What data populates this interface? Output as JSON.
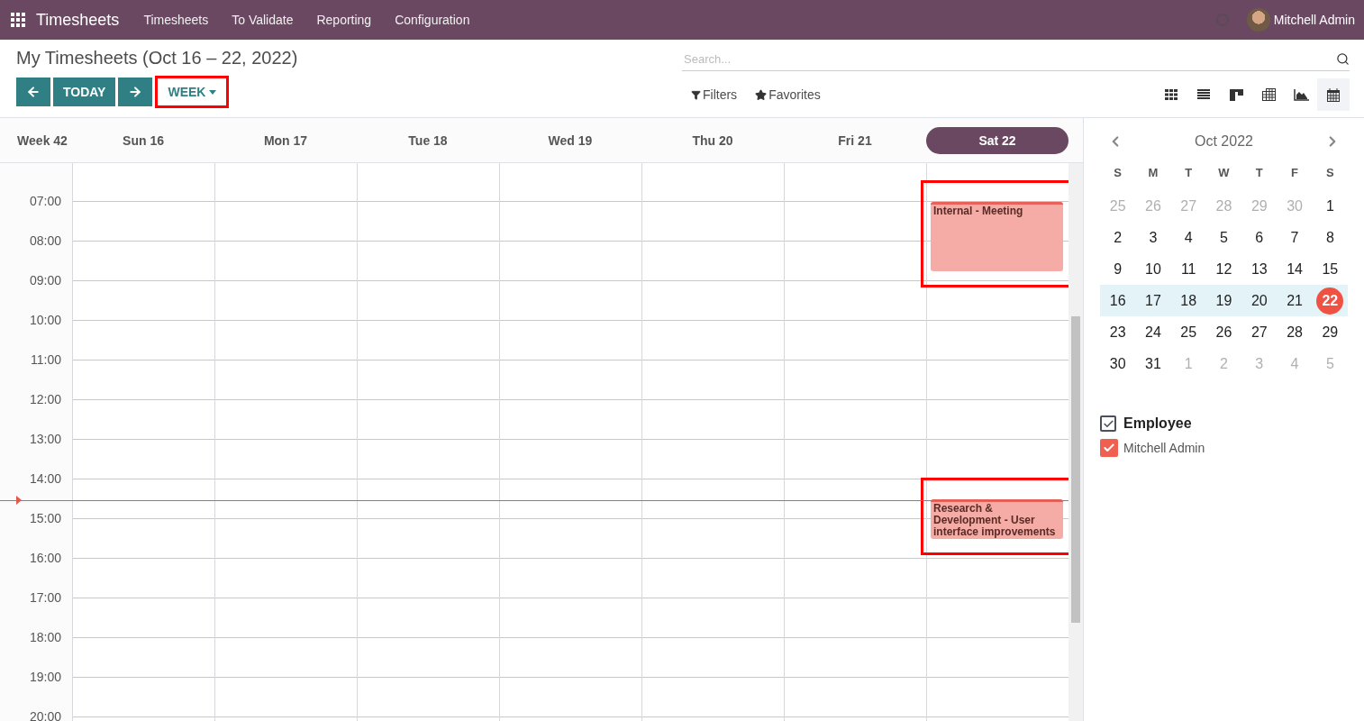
{
  "navbar": {
    "app_name": "Timesheets",
    "menus": [
      "Timesheets",
      "To Validate",
      "Reporting",
      "Configuration"
    ],
    "user": "Mitchell Admin"
  },
  "control_panel": {
    "title": "My Timesheets (Oct 16 – 22, 2022)",
    "today_label": "TODAY",
    "scale": {
      "label": "WEEK",
      "highlighted": true
    },
    "search": {
      "placeholder": "Search..."
    },
    "filters_label": "Filters",
    "favorites_label": "Favorites",
    "views": [
      {
        "kind": "kanban",
        "selected": false
      },
      {
        "kind": "list",
        "selected": false
      },
      {
        "kind": "grid",
        "selected": false
      },
      {
        "kind": "pivot",
        "selected": false
      },
      {
        "kind": "graph",
        "selected": false
      },
      {
        "kind": "calendar",
        "selected": true
      }
    ]
  },
  "calendar": {
    "week_label": "Week 42",
    "hours": [
      "07:00",
      "08:00",
      "09:00",
      "10:00",
      "11:00",
      "12:00",
      "13:00",
      "14:00",
      "15:00",
      "16:00",
      "17:00",
      "18:00",
      "19:00",
      "20:00"
    ],
    "days": [
      {
        "label": "Sun 16",
        "selected": false
      },
      {
        "label": "Mon 17",
        "selected": false
      },
      {
        "label": "Tue 18",
        "selected": false
      },
      {
        "label": "Wed 19",
        "selected": false
      },
      {
        "label": "Thu 20",
        "selected": false
      },
      {
        "label": "Fri 21",
        "selected": false
      },
      {
        "label": "Sat 22",
        "selected": true,
        "events": [
          {
            "title": "Internal - Meeting",
            "highlighted": true
          },
          {
            "title": "Research & Development - User interface improvements",
            "highlighted": true
          }
        ]
      }
    ]
  },
  "sidebar": {
    "month": "Oct 2022",
    "weekdays": [
      "S",
      "M",
      "T",
      "W",
      "T",
      "F",
      "S"
    ],
    "weeks": [
      {
        "selected": false,
        "days": [
          {
            "label": "25",
            "muted": true,
            "today": false
          },
          {
            "label": "26",
            "muted": true,
            "today": false
          },
          {
            "label": "27",
            "muted": true,
            "today": false
          },
          {
            "label": "28",
            "muted": true,
            "today": false
          },
          {
            "label": "29",
            "muted": true,
            "today": false
          },
          {
            "label": "30",
            "muted": true,
            "today": false
          },
          {
            "label": "1",
            "muted": false,
            "today": false
          }
        ]
      },
      {
        "selected": false,
        "days": [
          {
            "label": "2",
            "muted": false,
            "today": false
          },
          {
            "label": "3",
            "muted": false,
            "today": false
          },
          {
            "label": "4",
            "muted": false,
            "today": false
          },
          {
            "label": "5",
            "muted": false,
            "today": false
          },
          {
            "label": "6",
            "muted": false,
            "today": false
          },
          {
            "label": "7",
            "muted": false,
            "today": false
          },
          {
            "label": "8",
            "muted": false,
            "today": false
          }
        ]
      },
      {
        "selected": false,
        "days": [
          {
            "label": "9",
            "muted": false,
            "today": false
          },
          {
            "label": "10",
            "muted": false,
            "today": false
          },
          {
            "label": "11",
            "muted": false,
            "today": false
          },
          {
            "label": "12",
            "muted": false,
            "today": false
          },
          {
            "label": "13",
            "muted": false,
            "today": false
          },
          {
            "label": "14",
            "muted": false,
            "today": false
          },
          {
            "label": "15",
            "muted": false,
            "today": false
          }
        ]
      },
      {
        "selected": true,
        "days": [
          {
            "label": "16",
            "muted": false,
            "today": false
          },
          {
            "label": "17",
            "muted": false,
            "today": false
          },
          {
            "label": "18",
            "muted": false,
            "today": false
          },
          {
            "label": "19",
            "muted": false,
            "today": false
          },
          {
            "label": "20",
            "muted": false,
            "today": false
          },
          {
            "label": "21",
            "muted": false,
            "today": false
          },
          {
            "label": "22",
            "muted": false,
            "today": true
          }
        ]
      },
      {
        "selected": false,
        "days": [
          {
            "label": "23",
            "muted": false,
            "today": false
          },
          {
            "label": "24",
            "muted": false,
            "today": false
          },
          {
            "label": "25",
            "muted": false,
            "today": false
          },
          {
            "label": "26",
            "muted": false,
            "today": false
          },
          {
            "label": "27",
            "muted": false,
            "today": false
          },
          {
            "label": "28",
            "muted": false,
            "today": false
          },
          {
            "label": "29",
            "muted": false,
            "today": false
          }
        ]
      },
      {
        "selected": false,
        "days": [
          {
            "label": "30",
            "muted": false,
            "today": false
          },
          {
            "label": "31",
            "muted": false,
            "today": false
          },
          {
            "label": "1",
            "muted": true,
            "today": false
          },
          {
            "label": "2",
            "muted": true,
            "today": false
          },
          {
            "label": "3",
            "muted": true,
            "today": false
          },
          {
            "label": "4",
            "muted": true,
            "today": false
          },
          {
            "label": "5",
            "muted": true,
            "today": false
          }
        ]
      }
    ],
    "filter": {
      "title": "Employee",
      "checked": true,
      "items": [
        {
          "label": "Mitchell Admin",
          "checked": true,
          "color": "#f06050"
        }
      ]
    }
  }
}
